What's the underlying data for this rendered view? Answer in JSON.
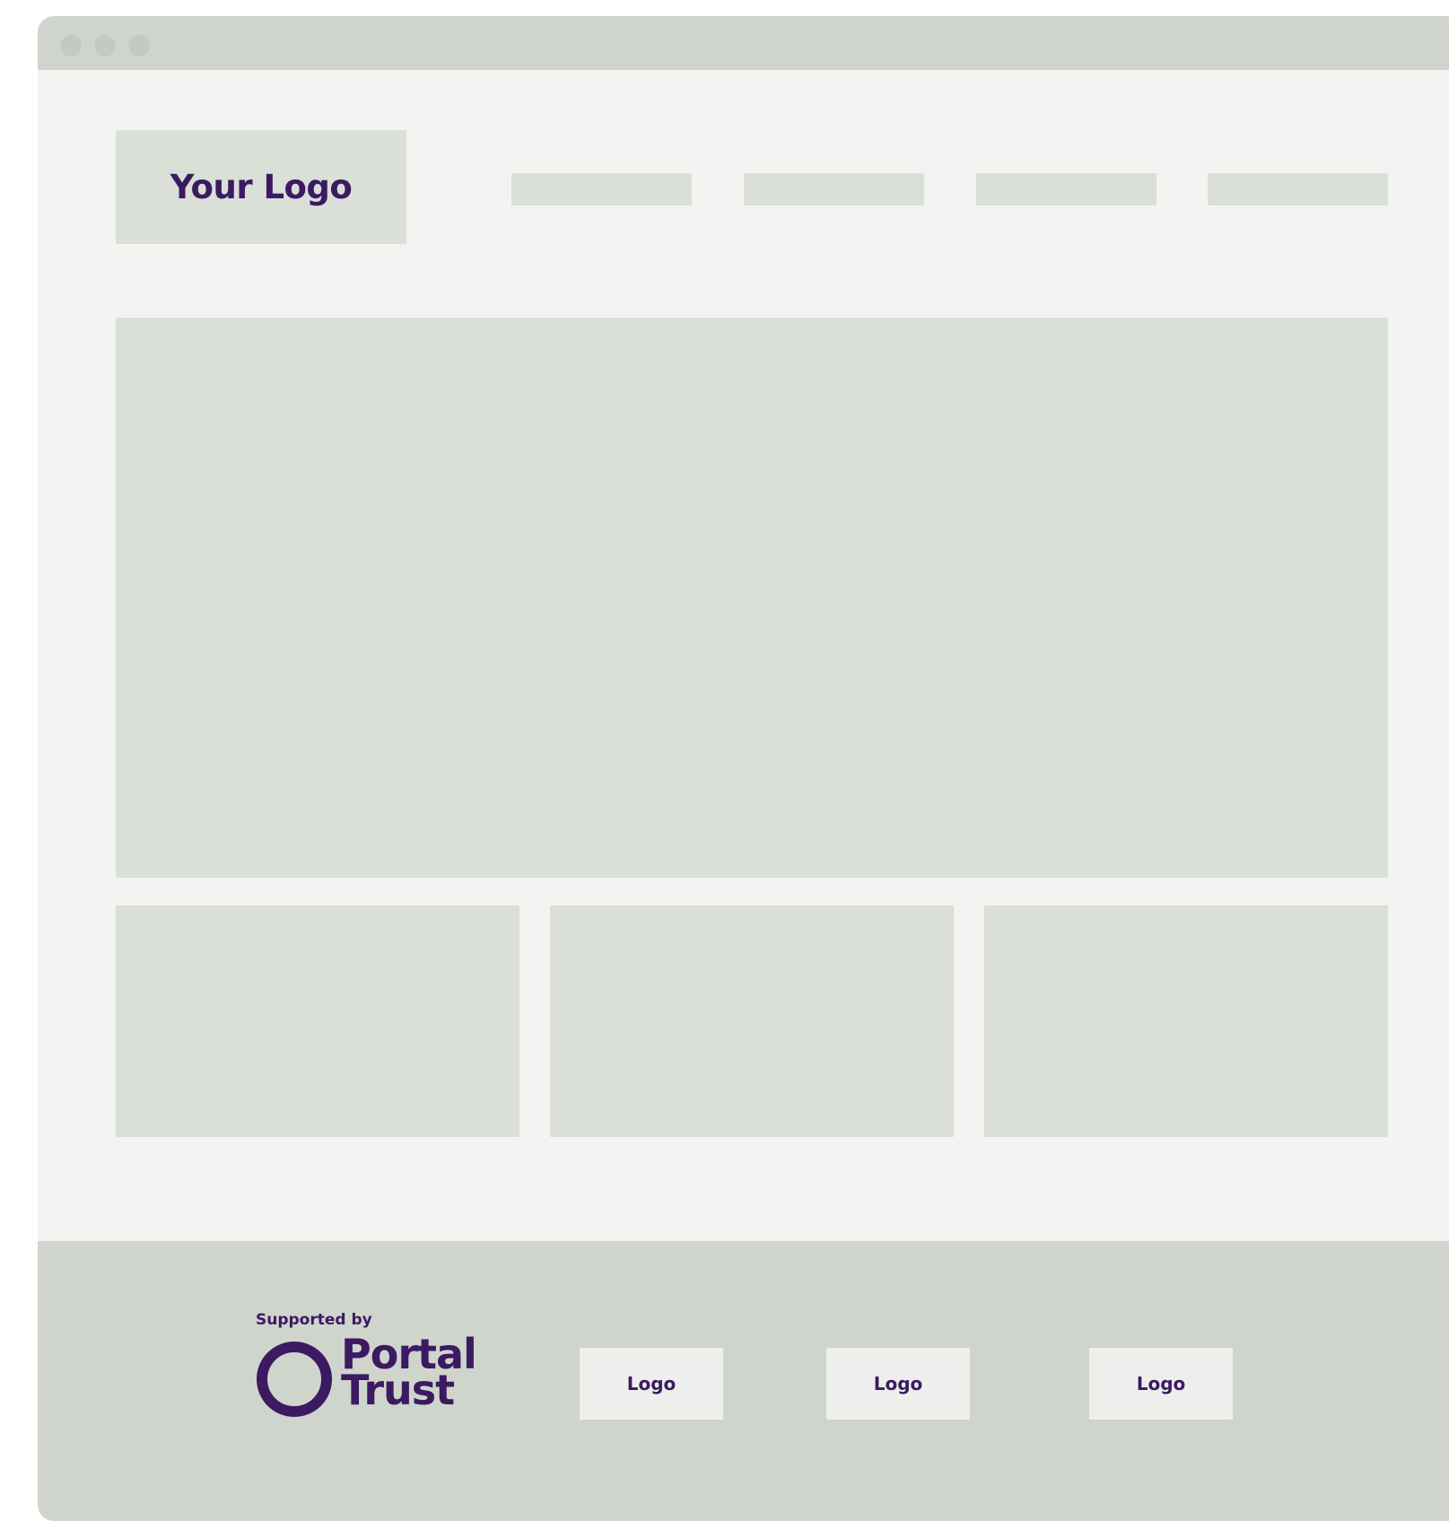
{
  "window": {
    "controls": [
      "close-dot",
      "minimize-dot",
      "maximize-dot"
    ]
  },
  "header": {
    "logo_text": "Your Logo",
    "nav_items": [
      "",
      "",
      "",
      ""
    ]
  },
  "footer": {
    "supported_by": "Supported by",
    "sponsor_name_line1": "Portal",
    "sponsor_name_line2": "Trust",
    "partner_logos": [
      "Logo",
      "Logo",
      "Logo"
    ]
  },
  "colors": {
    "brand_purple": "#3b1a62",
    "placeholder": "#dadfd7",
    "chrome": "#cfd5cc",
    "page_background": "#f3f4f1"
  }
}
